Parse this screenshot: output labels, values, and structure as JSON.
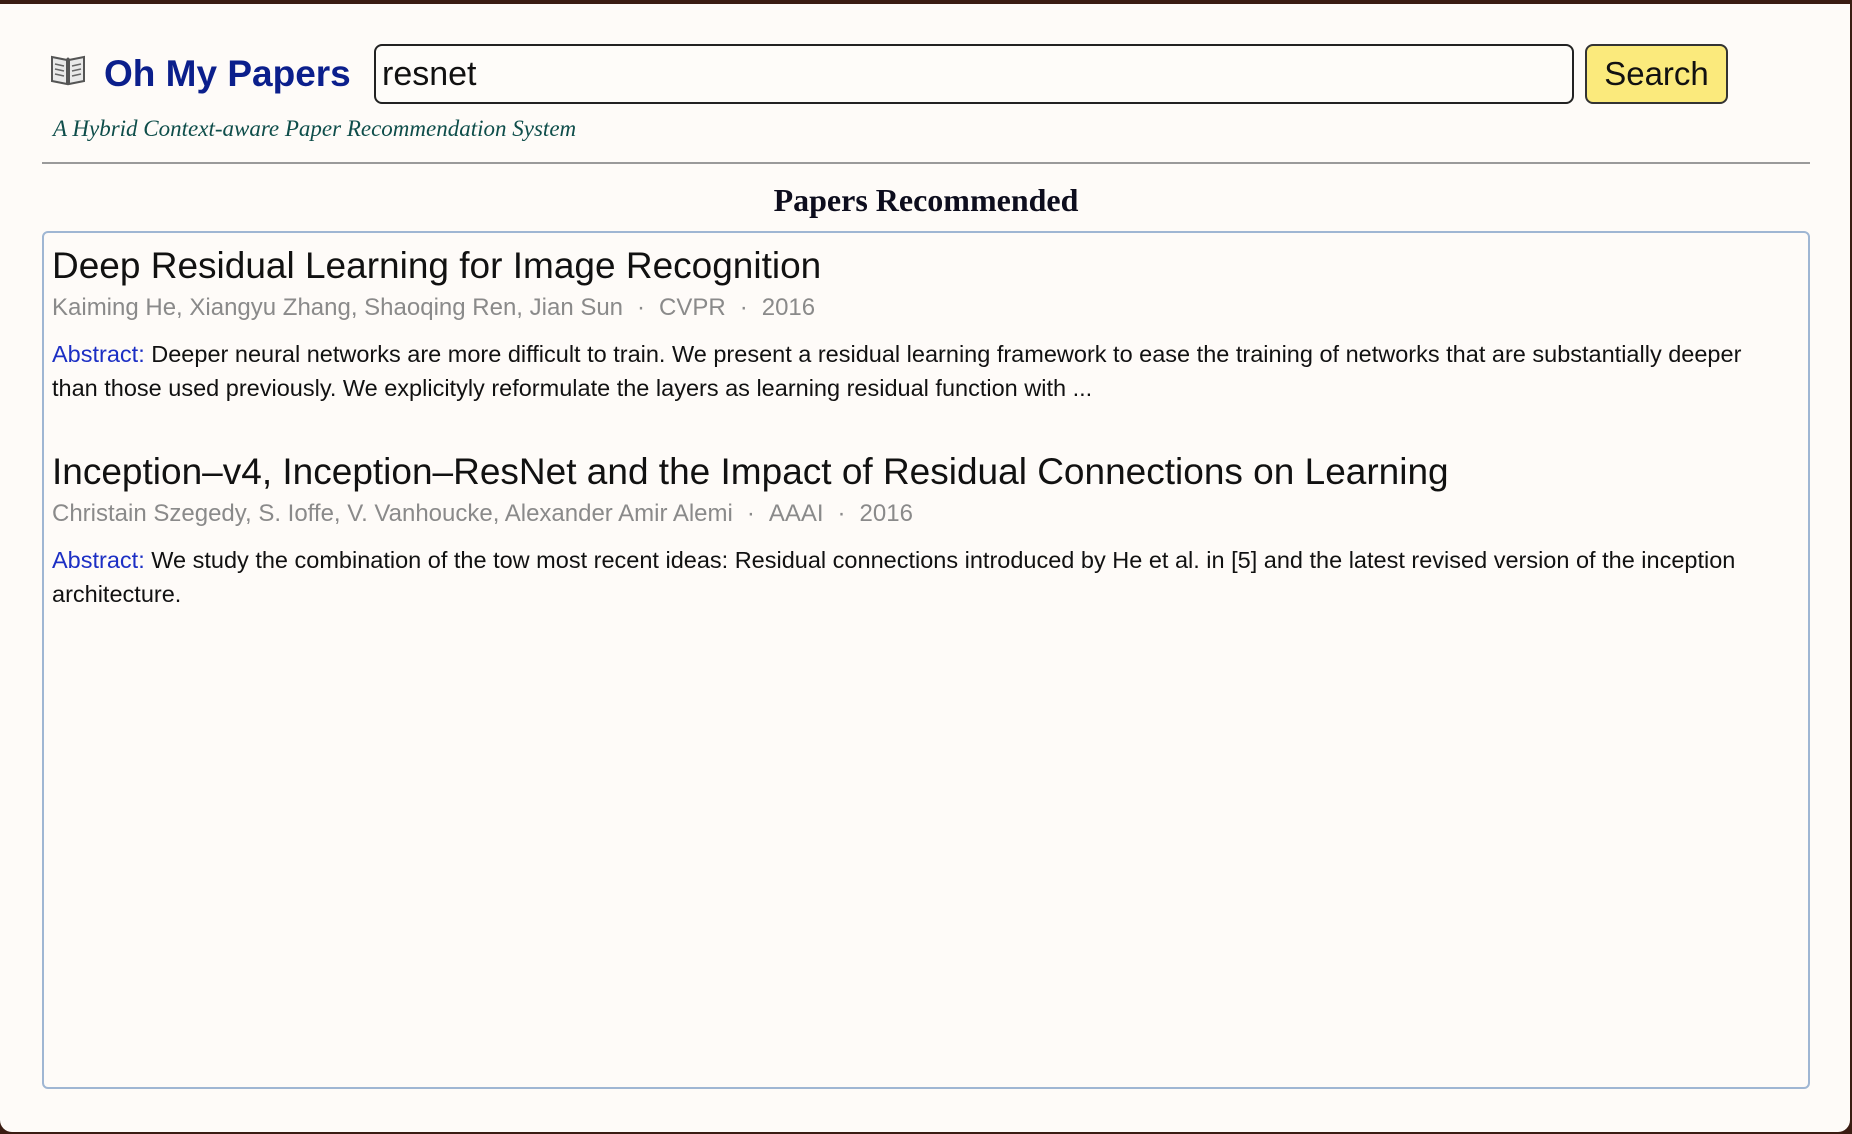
{
  "app": {
    "brand": "Oh My Papers",
    "tagline": "A Hybrid Context-aware Paper Recommendation System"
  },
  "search": {
    "value": "resnet",
    "button_label": "Search"
  },
  "results": {
    "heading": "Papers Recommended",
    "abstract_label": "Abstract:",
    "papers": [
      {
        "title": "Deep Residual Learning for Image Recognition",
        "authors": "Kaiming He, Xiangyu Zhang, Shaoqing Ren, Jian Sun",
        "venue": "CVPR",
        "year": "2016",
        "abstract": "Deeper neural networks are more difficult to train. We present a residual learning framework to ease the training of networks that are substantially deeper than those used previously. We explicityly reformulate the layers as learning residual function with ..."
      },
      {
        "title": "Inception–v4, Inception–ResNet and the Impact of Residual Connections on Learning",
        "authors": "Christain Szegedy, S. Ioffe, V. Vanhoucke, Alexander Amir Alemi",
        "venue": "AAAI",
        "year": "2016",
        "abstract": "We study the combination of the tow most recent ideas: Residual connections introduced by He et al. in [5] and the latest revised version of the inception architecture."
      }
    ]
  },
  "icons": {
    "logo": "open-book-icon",
    "meta_separator": "·"
  }
}
